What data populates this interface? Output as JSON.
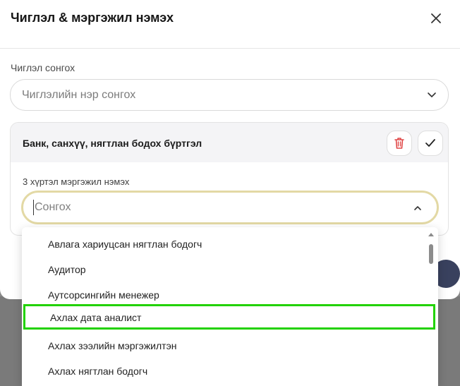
{
  "modal": {
    "title": "Чиглэл & мэргэжил нэмэх"
  },
  "direction": {
    "label": "Чиглэл сонгох",
    "placeholder": "Чиглэлийн нэр сонгох"
  },
  "card": {
    "title": "Банк, санхүү, нягтлан бодох бүртгэл",
    "sub_label": "3 хүртэл мэргэжил нэмэх",
    "combo_placeholder": "Сонгох"
  },
  "dropdown": {
    "options": [
      "Авлага хариуцсан нягтлан бодогч",
      "Аудитор",
      "Аутсорсингийн менежер",
      "Ахлах дата аналист",
      "Ахлах зээлийн мэргэжилтэн",
      "Ахлах нягтлан бодогч"
    ],
    "highlighted_index": 3
  },
  "colors": {
    "highlight": "#22d200",
    "combo_border": "#e3d9a5",
    "delete_icon": "#e04848",
    "primary_button": "#39415e"
  },
  "icons": {
    "close": "close-icon",
    "chevron_down": "chevron-down-icon",
    "chevron_up": "chevron-up-icon",
    "trash": "trash-icon",
    "check": "check-icon"
  }
}
